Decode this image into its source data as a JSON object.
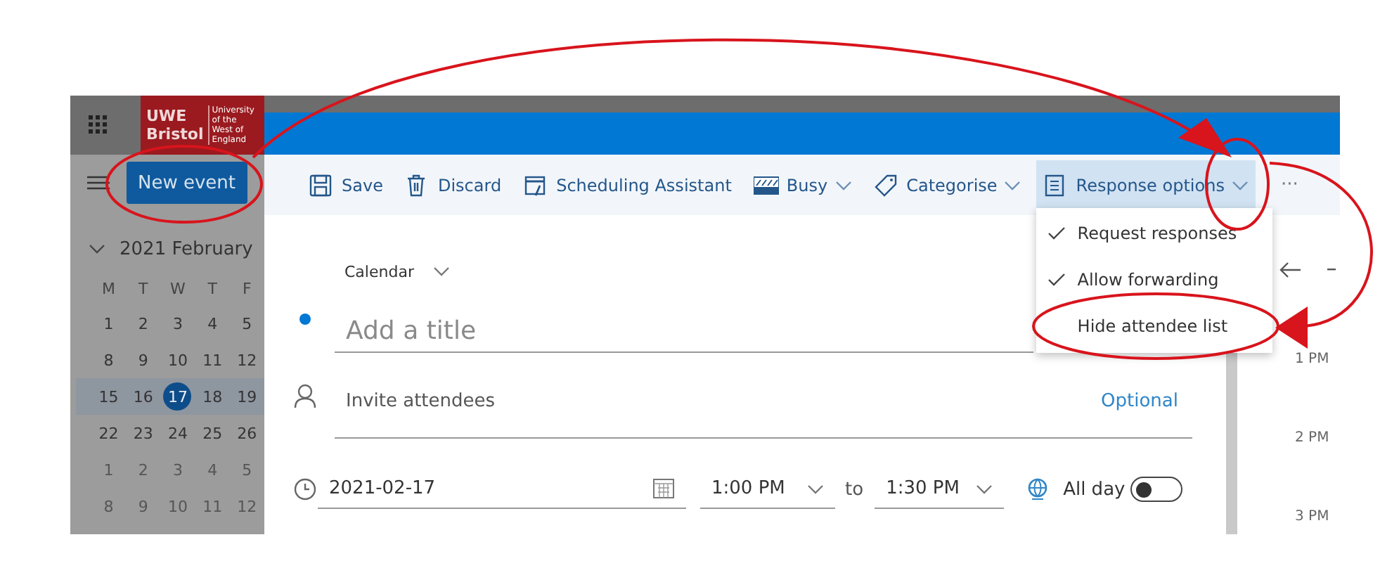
{
  "app_bar": {
    "logo": {
      "line_1": "UWE",
      "line_2": "Bristol",
      "tagline": "University of the West of England"
    }
  },
  "sidebar": {
    "new_event_button": "New event",
    "month": {
      "label": "2021 February",
      "expanded": true
    },
    "weekdays": [
      "M",
      "T",
      "W",
      "T",
      "F"
    ],
    "weeks": [
      {
        "highlighted": false,
        "other_month": false,
        "days": [
          {
            "label": "1",
            "selected": false
          },
          {
            "label": "2",
            "selected": false
          },
          {
            "label": "3",
            "selected": false
          },
          {
            "label": "4",
            "selected": false
          },
          {
            "label": "5",
            "selected": false
          }
        ]
      },
      {
        "highlighted": false,
        "other_month": false,
        "days": [
          {
            "label": "8",
            "selected": false
          },
          {
            "label": "9",
            "selected": false
          },
          {
            "label": "10",
            "selected": false
          },
          {
            "label": "11",
            "selected": false
          },
          {
            "label": "12",
            "selected": false
          }
        ]
      },
      {
        "highlighted": true,
        "other_month": false,
        "days": [
          {
            "label": "15",
            "selected": false
          },
          {
            "label": "16",
            "selected": false
          },
          {
            "label": "17",
            "selected": true
          },
          {
            "label": "18",
            "selected": false
          },
          {
            "label": "19",
            "selected": false
          }
        ]
      },
      {
        "highlighted": false,
        "other_month": false,
        "days": [
          {
            "label": "22",
            "selected": false
          },
          {
            "label": "23",
            "selected": false
          },
          {
            "label": "24",
            "selected": false
          },
          {
            "label": "25",
            "selected": false
          },
          {
            "label": "26",
            "selected": false
          }
        ]
      },
      {
        "highlighted": false,
        "other_month": true,
        "days": [
          {
            "label": "1",
            "selected": false
          },
          {
            "label": "2",
            "selected": false
          },
          {
            "label": "3",
            "selected": false
          },
          {
            "label": "4",
            "selected": false
          },
          {
            "label": "5",
            "selected": false
          }
        ]
      },
      {
        "highlighted": false,
        "other_month": true,
        "days": [
          {
            "label": "8",
            "selected": false
          },
          {
            "label": "9",
            "selected": false
          },
          {
            "label": "10",
            "selected": false
          },
          {
            "label": "11",
            "selected": false
          },
          {
            "label": "12",
            "selected": false
          }
        ]
      }
    ]
  },
  "toolbar": {
    "items": [
      {
        "label": "Save",
        "kind": "button",
        "expanded": false
      },
      {
        "label": "Discard",
        "kind": "button",
        "expanded": false
      },
      {
        "label": "Scheduling Assistant",
        "kind": "button",
        "expanded": false
      },
      {
        "label": "Busy",
        "kind": "dropdown",
        "expanded": false
      },
      {
        "label": "Categorise",
        "kind": "dropdown",
        "expanded": false
      },
      {
        "label": "Response options",
        "kind": "dropdown",
        "expanded": true
      }
    ],
    "more": "···"
  },
  "response_menu": {
    "items": [
      {
        "label": "Request responses",
        "checked": true
      },
      {
        "label": "Allow forwarding",
        "checked": true
      },
      {
        "label": "Hide attendee list",
        "checked": false
      }
    ]
  },
  "form": {
    "calendar_picker": "Calendar",
    "title": {
      "placeholder": "Add a title"
    },
    "attendees": {
      "placeholder": "Invite attendees",
      "optional_link": "Optional"
    },
    "date": "2021-02-17",
    "start_time": "1:00 PM",
    "separator": "to",
    "end_time": "1:30 PM",
    "all_day": {
      "label": "All day",
      "on": false
    }
  },
  "day_view": {
    "times": [
      "1 PM",
      "2 PM",
      "3 PM"
    ]
  }
}
